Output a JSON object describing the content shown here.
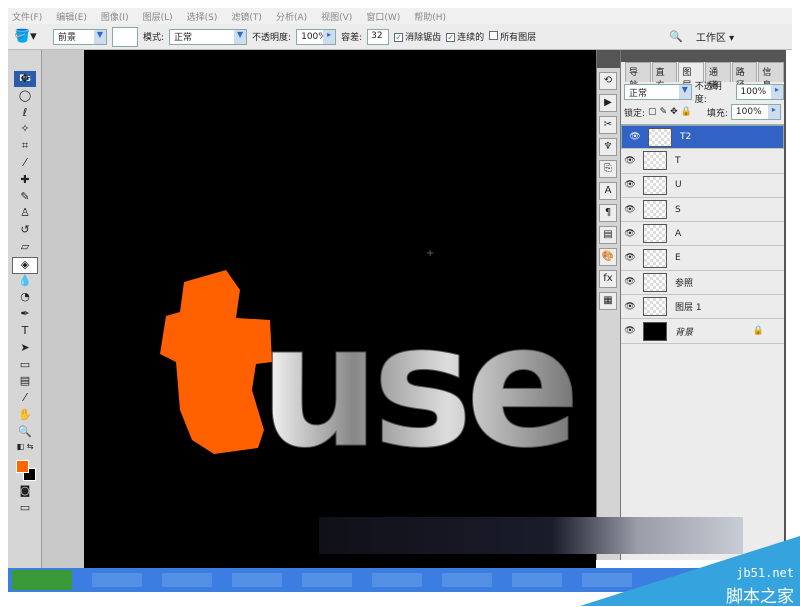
{
  "menu": [
    "文件(F)",
    "编辑(E)",
    "图像(I)",
    "图层(L)",
    "选择(S)",
    "滤镜(T)",
    "分析(A)",
    "视图(V)",
    "窗口(W)",
    "帮助(H)"
  ],
  "options": {
    "fill_source": "前景",
    "mode_label": "模式:",
    "mode": "正常",
    "opacity_label": "不透明度:",
    "opacity": "100%",
    "tolerance_label": "容差:",
    "tolerance": "32",
    "anti_alias": "消除锯齿",
    "anti_alias_checked": true,
    "contiguous": "连续的",
    "contiguous_checked": true,
    "all_layers": "所有图层",
    "all_layers_checked": false,
    "workspace": "工作区 ▾"
  },
  "toolbox": {
    "logo": "Ps",
    "foreground_color": "#ff6600",
    "background_color": "#000000"
  },
  "canvas": {
    "orange_letter": "t",
    "gray_text": "use",
    "accent": "#ff6000"
  },
  "layers_panel": {
    "tabs": [
      "导航",
      "直方",
      "图层",
      "通道",
      "路径",
      "信息"
    ],
    "active_tab": "图层",
    "blend_mode": "正常",
    "opacity_label": "不透明度:",
    "opacity": "100%",
    "lock_label": "锁定:",
    "fill_label": "填充:",
    "fill": "100%",
    "layers": [
      {
        "name": "T2",
        "selected": true
      },
      {
        "name": "T"
      },
      {
        "name": "U"
      },
      {
        "name": "S"
      },
      {
        "name": "A"
      },
      {
        "name": "E"
      },
      {
        "name": "参照"
      },
      {
        "name": "图层 1"
      },
      {
        "name": "背景",
        "locked": true
      }
    ]
  },
  "watermark": {
    "site": "jb51.net",
    "name": "脚本之家"
  }
}
